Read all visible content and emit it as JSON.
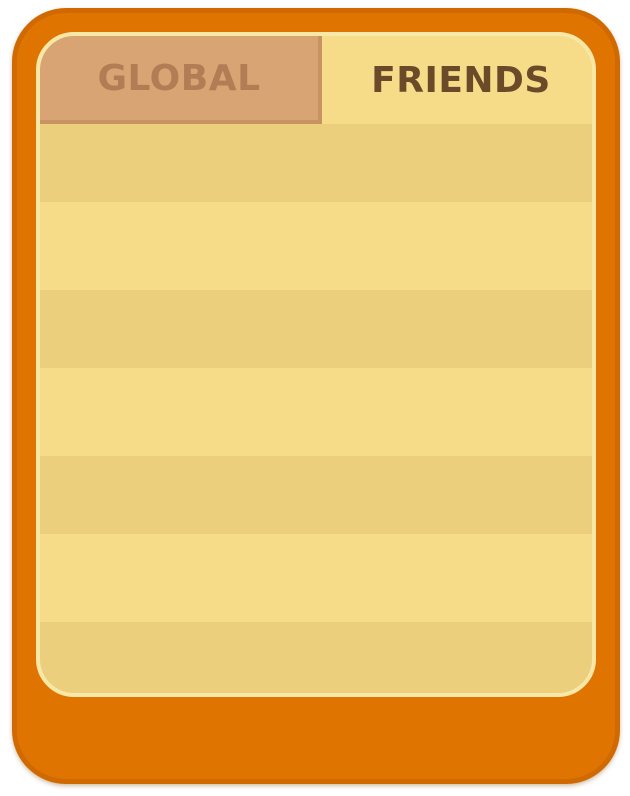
{
  "tabs": {
    "global_label": "GLOBAL",
    "friends_label": "FRIENDS",
    "active": "friends"
  },
  "leaderboard": {
    "entries": []
  },
  "colors": {
    "frame": "#e07400",
    "panel": "#f6dc88",
    "row_alt": "#ebcf7c",
    "tab_inactive": "#d8a473",
    "text_active": "#6a4a28"
  }
}
